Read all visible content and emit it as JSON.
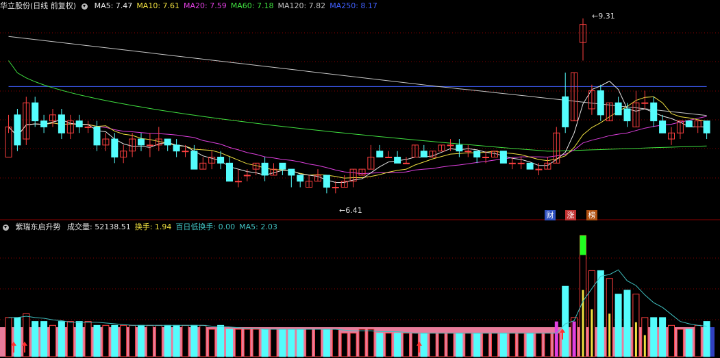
{
  "main_header": {
    "stock_label": "华立股份(日线 前复权)",
    "ma": [
      {
        "label": "MA5: 7.47",
        "color": "#e8e8e8"
      },
      {
        "label": "MA10: 7.61",
        "color": "#f0e040"
      },
      {
        "label": "MA20: 7.59",
        "color": "#e040e0"
      },
      {
        "label": "MA60: 7.18",
        "color": "#40e040"
      },
      {
        "label": "MA120: 7.82",
        "color": "#c0c0c0"
      },
      {
        "label": "MA250: 8.17",
        "color": "#4060ff"
      }
    ]
  },
  "sub_header": {
    "title": "紫瑞东启升势",
    "items": [
      {
        "label": "成交量: 52138.51",
        "color": "#e0e0e0"
      },
      {
        "label": "换手: 1.94",
        "color": "#f0e040"
      },
      {
        "label": "百日低换手: 0.00",
        "color": "#40c0c0"
      },
      {
        "label": "MA5: 2.03",
        "color": "#40c0c0"
      }
    ]
  },
  "annotations": {
    "high": "9.31",
    "low": "6.41"
  },
  "badges": [
    {
      "text": "财",
      "bg": "#3050c0"
    },
    {
      "text": "涨",
      "bg": "#c03030"
    },
    {
      "text": "榜",
      "bg": "#b05010"
    }
  ],
  "colors": {
    "up": "#ff4040",
    "down": "#54fcfc",
    "grid": "#8b0000",
    "volume_band": "#e77c9b",
    "limit_up": "#20ff20"
  },
  "chart_data": {
    "type": "candlestick",
    "price_range": [
      6.2,
      9.4
    ],
    "candles": [
      [
        7.0,
        7.5,
        7.7,
        7.4
      ],
      [
        7.7,
        7.2,
        7.8,
        7.1
      ],
      [
        7.3,
        7.9,
        8.0,
        7.2
      ],
      [
        7.9,
        7.6,
        8.0,
        7.5
      ],
      [
        7.6,
        7.5,
        7.7,
        7.4
      ],
      [
        7.6,
        7.7,
        7.8,
        7.5
      ],
      [
        7.7,
        7.4,
        7.8,
        7.3
      ],
      [
        7.4,
        7.6,
        7.7,
        7.3
      ],
      [
        7.6,
        7.5,
        7.7,
        7.4
      ],
      [
        7.5,
        7.5,
        7.6,
        7.4
      ],
      [
        7.5,
        7.2,
        7.6,
        7.1
      ],
      [
        7.2,
        7.3,
        7.4,
        7.1
      ],
      [
        7.3,
        7.0,
        7.4,
        6.9
      ],
      [
        7.0,
        7.1,
        7.2,
        6.9
      ],
      [
        7.1,
        7.3,
        7.4,
        7.0
      ],
      [
        7.3,
        7.2,
        7.4,
        7.1
      ],
      [
        7.2,
        7.2,
        7.4,
        7.0
      ],
      [
        7.2,
        7.3,
        7.5,
        7.1
      ],
      [
        7.3,
        7.2,
        7.3,
        7.1
      ],
      [
        7.2,
        7.1,
        7.3,
        7.0
      ],
      [
        7.1,
        7.1,
        7.2,
        7.0
      ],
      [
        7.1,
        6.8,
        7.2,
        6.8
      ],
      [
        6.8,
        6.9,
        7.0,
        6.8
      ],
      [
        6.9,
        7.0,
        7.1,
        6.8
      ],
      [
        7.0,
        6.9,
        7.1,
        6.8
      ],
      [
        6.9,
        6.6,
        7.0,
        6.6
      ],
      [
        6.6,
        6.6,
        6.8,
        6.5
      ],
      [
        6.7,
        6.7,
        6.8,
        6.6
      ],
      [
        6.8,
        6.9,
        6.9,
        6.7
      ],
      [
        6.9,
        6.7,
        7.0,
        6.6
      ],
      [
        6.7,
        6.8,
        6.9,
        6.7
      ],
      [
        6.9,
        6.8,
        6.9,
        6.7
      ],
      [
        6.8,
        6.7,
        6.8,
        6.5
      ],
      [
        6.7,
        6.6,
        6.7,
        6.5
      ],
      [
        6.5,
        6.6,
        6.7,
        6.5
      ],
      [
        6.6,
        6.7,
        6.8,
        6.6
      ],
      [
        6.7,
        6.5,
        6.7,
        6.4
      ],
      [
        6.5,
        6.5,
        6.6,
        6.4
      ],
      [
        6.5,
        6.6,
        6.7,
        6.5
      ],
      [
        6.6,
        6.8,
        6.8,
        6.5
      ],
      [
        6.7,
        6.8,
        6.8,
        6.7
      ],
      [
        6.8,
        7.0,
        7.2,
        6.8
      ],
      [
        7.1,
        7.0,
        7.2,
        7.0
      ],
      [
        7.0,
        7.0,
        7.1,
        7.0
      ],
      [
        7.0,
        6.9,
        7.1,
        6.9
      ],
      [
        6.9,
        6.9,
        7.0,
        6.9
      ],
      [
        7.0,
        7.2,
        7.2,
        7.0
      ],
      [
        7.1,
        7.0,
        7.2,
        7.0
      ],
      [
        7.0,
        7.1,
        7.1,
        7.0
      ],
      [
        7.1,
        7.2,
        7.2,
        7.1
      ],
      [
        7.2,
        7.2,
        7.3,
        7.1
      ],
      [
        7.2,
        7.1,
        7.3,
        7.0
      ],
      [
        7.1,
        7.1,
        7.2,
        7.0
      ],
      [
        7.1,
        7.0,
        7.1,
        6.9
      ],
      [
        7.0,
        7.0,
        7.1,
        6.9
      ],
      [
        7.0,
        7.1,
        7.1,
        7.0
      ],
      [
        7.1,
        6.9,
        7.1,
        6.9
      ],
      [
        6.9,
        6.9,
        7.0,
        6.8
      ],
      [
        6.9,
        6.9,
        7.0,
        6.8
      ],
      [
        6.9,
        6.8,
        6.9,
        6.8
      ],
      [
        6.8,
        6.8,
        6.9,
        6.7
      ],
      [
        6.8,
        6.9,
        7.0,
        6.8
      ],
      [
        6.9,
        7.4,
        7.5,
        6.9
      ],
      [
        8.0,
        7.5,
        8.4,
        7.4
      ],
      [
        7.6,
        8.4,
        8.4,
        7.6
      ],
      [
        8.9,
        9.2,
        9.3,
        8.6
      ],
      [
        7.8,
        8.1,
        8.2,
        7.7
      ],
      [
        8.1,
        7.7,
        8.2,
        7.6
      ],
      [
        7.6,
        7.9,
        7.9,
        7.6
      ],
      [
        7.9,
        7.7,
        8.0,
        7.7
      ],
      [
        7.8,
        7.6,
        7.9,
        7.5
      ],
      [
        7.5,
        7.9,
        8.1,
        7.5
      ],
      [
        7.9,
        7.9,
        8.1,
        7.8
      ],
      [
        7.9,
        7.6,
        8.0,
        7.5
      ],
      [
        7.6,
        7.4,
        7.7,
        7.4
      ],
      [
        7.3,
        7.4,
        7.5,
        7.2
      ],
      [
        7.4,
        7.6,
        7.6,
        7.3
      ],
      [
        7.6,
        7.5,
        7.6,
        7.5
      ],
      [
        7.5,
        7.6,
        7.6,
        7.4
      ],
      [
        7.6,
        7.4,
        7.6,
        7.3
      ]
    ],
    "volumes": [
      1.0,
      1.0,
      1.1,
      0.9,
      0.9,
      0.8,
      0.9,
      0.9,
      0.9,
      0.9,
      0.8,
      0.8,
      0.8,
      0.8,
      0.8,
      0.8,
      0.8,
      0.8,
      0.8,
      0.8,
      0.8,
      0.8,
      0.8,
      0.7,
      0.8,
      0.7,
      0.7,
      0.7,
      0.7,
      0.7,
      0.7,
      0.7,
      0.7,
      0.7,
      0.7,
      0.7,
      0.7,
      0.7,
      0.6,
      0.6,
      0.7,
      0.7,
      0.6,
      0.6,
      0.6,
      0.6,
      0.6,
      0.6,
      0.6,
      0.6,
      0.6,
      0.6,
      0.6,
      0.6,
      0.6,
      0.6,
      0.6,
      0.6,
      0.6,
      0.6,
      0.6,
      0.6,
      0.6,
      1.8,
      1.0,
      3.1,
      2.2,
      2.2,
      2.0,
      1.6,
      1.7,
      1.6,
      1.0,
      1.0,
      1.0,
      0.8,
      0.7,
      0.7,
      0.8,
      0.9
    ]
  }
}
